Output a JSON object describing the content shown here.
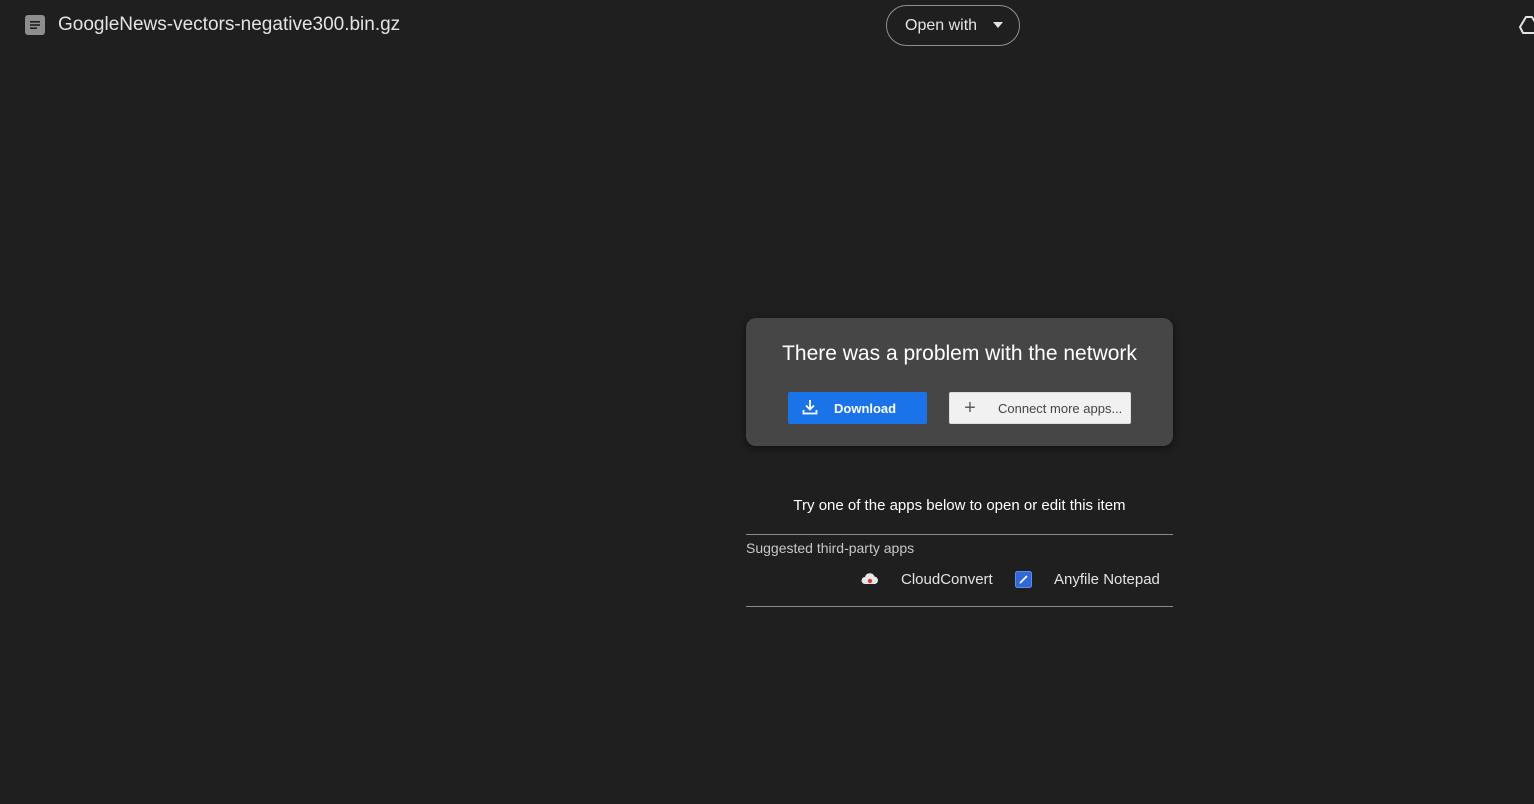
{
  "header": {
    "file_title": "GoogleNews-vectors-negative300.bin.gz",
    "open_with_label": "Open with",
    "file_icon": "text-document-icon",
    "add_icon": "add-to-drive-icon"
  },
  "error_card": {
    "message": "There was a problem with the network",
    "download_label": "Download",
    "download_icon": "download-icon",
    "connect_label": "Connect more apps...",
    "connect_icon": "plus-icon"
  },
  "suggestions": {
    "prompt": "Try one of the apps below to open or edit this item",
    "section_label": "Suggested third-party apps",
    "apps": [
      {
        "name": "CloudConvert",
        "icon": "cloudconvert-icon"
      },
      {
        "name": "Anyfile Notepad",
        "icon": "anyfile-notepad-icon"
      }
    ]
  },
  "colors": {
    "background": "#1f1f1f",
    "card": "#474647",
    "primary_button": "#1a73e8",
    "secondary_button": "#f1f1f1"
  }
}
